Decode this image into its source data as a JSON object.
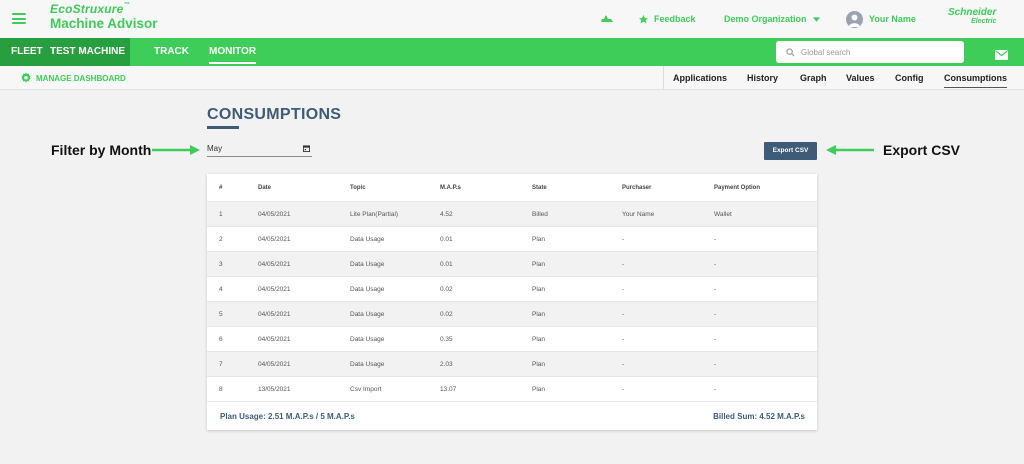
{
  "topbar": {
    "brand_eco": "EcoStruxure",
    "brand_tm": "™",
    "app_name": "Machine Advisor",
    "feedback": "Feedback",
    "organization": "Demo Organization",
    "user_name": "Your Name",
    "vendor_line1": "Schneider",
    "vendor_line2": "Electric"
  },
  "nav": {
    "fleet": "FLEET",
    "machine": "TEST MACHINE",
    "track": "TRACK",
    "monitor": "MONITOR",
    "active": "MONITOR"
  },
  "search": {
    "placeholder": "Global search"
  },
  "subnav": {
    "manage_dashboard": "MANAGE DASHBOARD",
    "tabs": [
      {
        "label": "Applications"
      },
      {
        "label": "History"
      },
      {
        "label": "Graph"
      },
      {
        "label": "Values"
      },
      {
        "label": "Config"
      },
      {
        "label": "Consumptions"
      }
    ],
    "active_tab": "Consumptions"
  },
  "page": {
    "title": "CONSUMPTIONS",
    "month_value": "May",
    "export_label": "Export CSV",
    "annotation_filter": "Filter by Month",
    "annotation_export": "Export CSV"
  },
  "table": {
    "columns": [
      "#",
      "Date",
      "Topic",
      "M.A.P.s",
      "State",
      "Purchaser",
      "Payment Option"
    ],
    "rows": [
      [
        "1",
        "04/05/2021",
        "Lite Plan(Partial)",
        "4.52",
        "Billed",
        "Your Name",
        "Wallet"
      ],
      [
        "2",
        "04/05/2021",
        "Data Usage",
        "0.01",
        "Plan",
        "-",
        "-"
      ],
      [
        "3",
        "04/05/2021",
        "Data Usage",
        "0.01",
        "Plan",
        "-",
        "-"
      ],
      [
        "4",
        "04/05/2021",
        "Data Usage",
        "0.02",
        "Plan",
        "-",
        "-"
      ],
      [
        "5",
        "04/05/2021",
        "Data Usage",
        "0.02",
        "Plan",
        "-",
        "-"
      ],
      [
        "6",
        "04/05/2021",
        "Data Usage",
        "0.35",
        "Plan",
        "-",
        "-"
      ],
      [
        "7",
        "04/05/2021",
        "Data Usage",
        "2.03",
        "Plan",
        "-",
        "-"
      ],
      [
        "8",
        "13/05/2021",
        "Csv Import",
        "13.07",
        "Plan",
        "-",
        "-"
      ]
    ],
    "plan_usage": "Plan Usage:  2.51 M.A.P.s  / 5 M.A.P.s",
    "billed_sum": "Billed Sum:  4.52 M.A.P.s"
  },
  "colors": {
    "brand_green": "#3dcd58",
    "dark_green": "#289f3f",
    "slate_blue": "#3e5c78"
  }
}
